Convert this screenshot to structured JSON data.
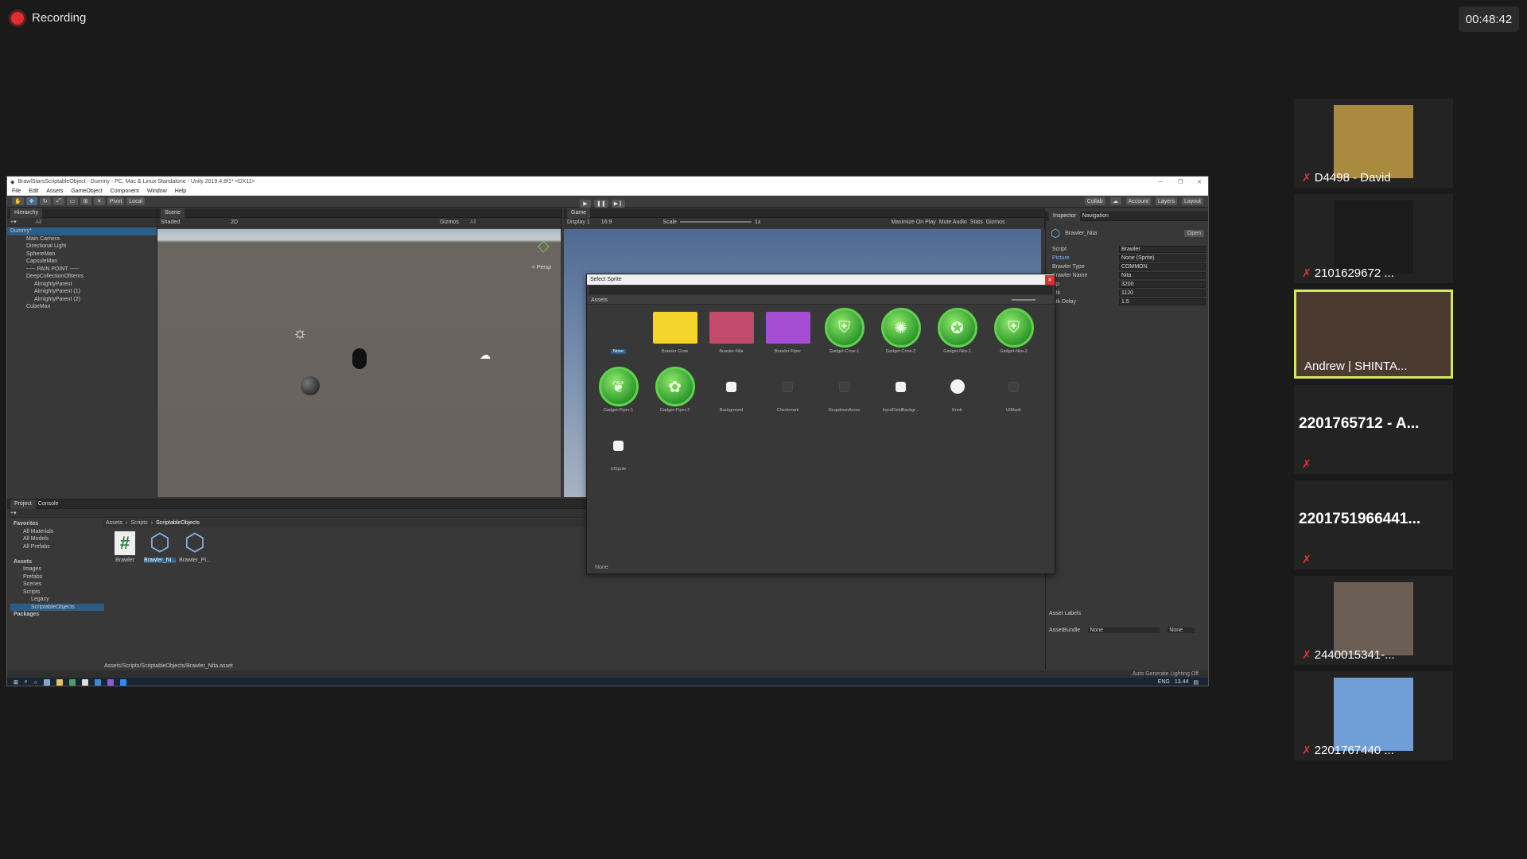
{
  "recording": {
    "label": "Recording",
    "timer": "00:48:42"
  },
  "unity": {
    "window_title": "BrawlStarsScriptableObject - Dummy - PC, Mac & Linux Standalone - Unity 2019.4.8f1* <DX11>",
    "menu": [
      "File",
      "Edit",
      "Assets",
      "GameObject",
      "Component",
      "Window",
      "Help"
    ],
    "toolbar": {
      "pivot": "Pivot",
      "local": "Local",
      "collab": "Collab",
      "account": "Account",
      "layers": "Layers",
      "layout": "Layout"
    },
    "hierarchy": {
      "tab": "Hierarchy",
      "search_placeholder": "All",
      "items": [
        "Dummy*",
        "Main Camera",
        "Directional Light",
        "SphereMan",
        "CapsuleMan",
        "----- PAIN POINT -----",
        "DeepCollectionOfItems",
        "AlmightyParent",
        "AlmightyParent (1)",
        "AlmightyParent (2)",
        "CubeMan"
      ]
    },
    "scene": {
      "tab": "Scene",
      "shading": "Shaded",
      "mode2d": "2D",
      "gizmos": "Gizmos",
      "all": "All",
      "persp": "< Persp"
    },
    "game": {
      "tab": "Game",
      "display": "Display 1",
      "aspect": "16:9",
      "scale_label": "Scale",
      "scale_value": "1x",
      "maximize": "Maximize On Play",
      "mute": "Mute Audio",
      "stats": "Stats",
      "gizmos": "Gizmos"
    },
    "select_sprite": {
      "title": "Select Sprite",
      "tab": "Assets",
      "footer": "None",
      "items": [
        {
          "label": "None",
          "kind": "none"
        },
        {
          "label": "Brawler-Crow",
          "kind": "card",
          "color": "#f4d52c"
        },
        {
          "label": "Brawler-Nita",
          "kind": "card",
          "color": "#c24a6a"
        },
        {
          "label": "Brawler-Piper",
          "kind": "card",
          "color": "#a64ed3"
        },
        {
          "label": "Gadget-Crow-1",
          "kind": "gadget",
          "glyph": "⛨"
        },
        {
          "label": "Gadget-Crow-2",
          "kind": "gadget",
          "glyph": "✺"
        },
        {
          "label": "Gadget-Nita-1",
          "kind": "gadget",
          "glyph": "✪"
        },
        {
          "label": "Gadget-Nita-2",
          "kind": "gadget",
          "glyph": "⛨"
        },
        {
          "label": "Gadget-Piper-1",
          "kind": "gadget",
          "glyph": "❦"
        },
        {
          "label": "Gadget-Piper-2",
          "kind": "gadget",
          "glyph": "✿"
        },
        {
          "label": "Background",
          "kind": "sq"
        },
        {
          "label": "Checkmark",
          "kind": "sqdark"
        },
        {
          "label": "DropdownArrow",
          "kind": "sqdark"
        },
        {
          "label": "InputFieldBackgr...",
          "kind": "sq"
        },
        {
          "label": "Knob",
          "kind": "knob"
        },
        {
          "label": "UIMask",
          "kind": "sqdark"
        },
        {
          "label": "UISprite",
          "kind": "sq"
        }
      ]
    },
    "inspector": {
      "tabs": [
        "Inspector",
        "Navigation"
      ],
      "object": "Brawler_Nita",
      "open_button": "Open",
      "fields": [
        {
          "key": "Script",
          "value": "Brawler"
        },
        {
          "key": "Picture",
          "value": "None (Sprite)"
        },
        {
          "key": "Brawler Type",
          "value": "COMMON"
        },
        {
          "key": "Brawler Name",
          "value": "Nita"
        },
        {
          "key": "Hp",
          "value": "3200"
        },
        {
          "key": "Atk",
          "value": "1120"
        },
        {
          "key": "Atk Delay",
          "value": "1.5"
        }
      ],
      "asset_labels": "Asset Labels",
      "asset_bundle": "AssetBundle",
      "bundle_value": "None",
      "bundle_variant": "None"
    },
    "project": {
      "tabs": [
        "Project",
        "Console"
      ],
      "favorites": "Favorites",
      "fav_items": [
        "All Materials",
        "All Models",
        "All Prefabs"
      ],
      "assets_root": "Assets",
      "folders": [
        "Images",
        "Prefabs",
        "Scenes",
        "Scripts",
        "Legacy",
        "ScriptableObjects"
      ],
      "packages": "Packages",
      "breadcrumb": [
        "Assets",
        "Scripts",
        "ScriptableObjects"
      ],
      "files": [
        "Brawler",
        "Brawler_Ni...",
        "Brawler_Pi..."
      ],
      "path": "Assets/Scripts/ScriptableObjects/Brawler_Nita.asset"
    },
    "status": "Auto Generate Lighting Off",
    "tray": {
      "lang": "ENG",
      "time": "13.44"
    }
  },
  "participants": [
    {
      "name": "D4498 - David",
      "kind": "video",
      "color": "#a98a3e"
    },
    {
      "name": "2101629672 ...",
      "kind": "video",
      "color": "#1b1b1b"
    },
    {
      "name": "Andrew | SHINTA...",
      "kind": "video",
      "color": "#4a3a30",
      "active": true
    },
    {
      "name": "2201765712 - A...",
      "kind": "name"
    },
    {
      "name": "2201751966441...",
      "kind": "name"
    },
    {
      "name": "2440015341-...",
      "kind": "video",
      "color": "#6a5e55"
    },
    {
      "name": "2201767440 ...",
      "kind": "video",
      "color": "#6f9fd6"
    }
  ]
}
